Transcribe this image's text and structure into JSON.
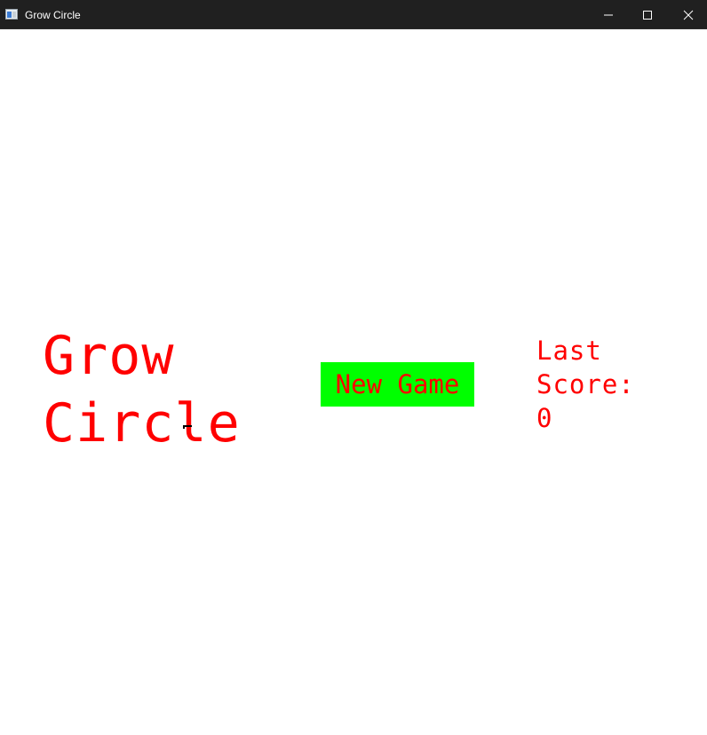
{
  "window": {
    "title": "Grow Circle",
    "controls": {
      "minimize_icon": "minimize-icon",
      "maximize_icon": "maximize-icon",
      "close_icon": "close-icon"
    }
  },
  "game": {
    "title_line1": "Grow",
    "title_line2": "Circle",
    "new_game_label": "New Game",
    "last_score_label_line1": "Last",
    "last_score_label_line2": "Score:",
    "last_score_value": "0"
  },
  "colors": {
    "text": "#ff0000",
    "button_bg": "#00ff00",
    "background": "#ffffff",
    "titlebar": "#202020"
  }
}
